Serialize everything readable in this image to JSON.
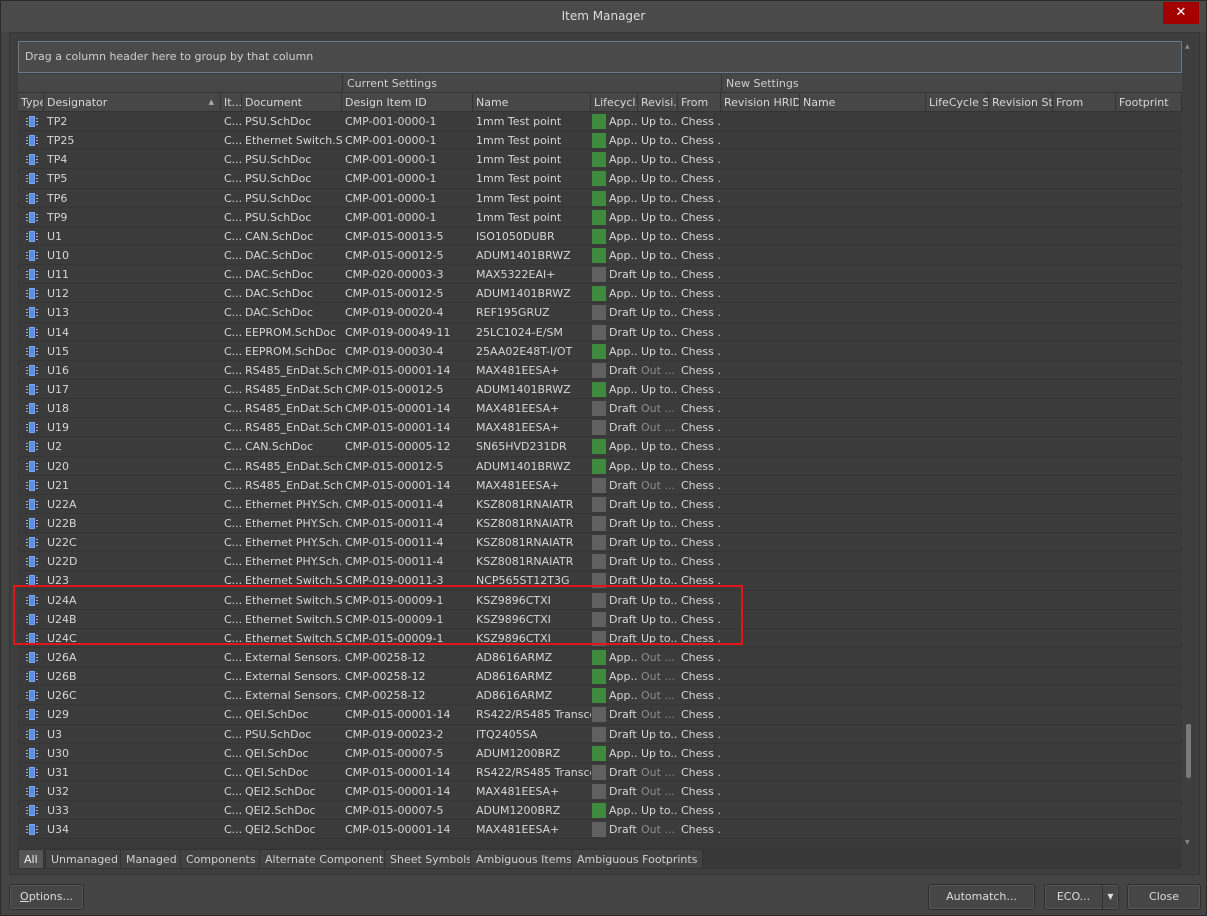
{
  "window": {
    "title": "Item Manager",
    "close_icon": "close-icon"
  },
  "group_bar": {
    "text": "Drag a column header here to group by that column"
  },
  "bands": {
    "current": "Current Settings",
    "new": "New Settings"
  },
  "columns": {
    "type": "Type",
    "designator": "Designator",
    "item": "It...",
    "document": "Document",
    "design_item_id": "Design Item ID",
    "name": "Name",
    "lifecycle": "Lifecycl...",
    "revision": "Revisi...",
    "from": "From",
    "new_revision_hrid": "Revision HRID",
    "new_name": "Name",
    "new_lifecycle": "LifeCycle S...",
    "new_revision_status": "Revision St...",
    "new_from": "From",
    "new_footprint": "Footprint"
  },
  "colors": {
    "approved": "#3f8a3f",
    "draft": "#606060",
    "highlight": "#e0161e"
  },
  "rows": [
    {
      "designator": "TP2",
      "item": "C...",
      "document": "PSU.SchDoc",
      "design_item_id": "CMP-001-0000-1",
      "name": "1mm Test point",
      "lifecycle": "App...",
      "lc": "approved",
      "revision": "Up to...",
      "rev_dim": false,
      "from": "Chess ..."
    },
    {
      "designator": "TP25",
      "item": "C...",
      "document": "Ethernet Switch.Sc...",
      "design_item_id": "CMP-001-0000-1",
      "name": "1mm Test point",
      "lifecycle": "App...",
      "lc": "approved",
      "revision": "Up to...",
      "rev_dim": false,
      "from": "Chess ..."
    },
    {
      "designator": "TP4",
      "item": "C...",
      "document": "PSU.SchDoc",
      "design_item_id": "CMP-001-0000-1",
      "name": "1mm Test point",
      "lifecycle": "App...",
      "lc": "approved",
      "revision": "Up to...",
      "rev_dim": false,
      "from": "Chess ..."
    },
    {
      "designator": "TP5",
      "item": "C...",
      "document": "PSU.SchDoc",
      "design_item_id": "CMP-001-0000-1",
      "name": "1mm Test point",
      "lifecycle": "App...",
      "lc": "approved",
      "revision": "Up to...",
      "rev_dim": false,
      "from": "Chess ..."
    },
    {
      "designator": "TP6",
      "item": "C...",
      "document": "PSU.SchDoc",
      "design_item_id": "CMP-001-0000-1",
      "name": "1mm Test point",
      "lifecycle": "App...",
      "lc": "approved",
      "revision": "Up to...",
      "rev_dim": false,
      "from": "Chess ..."
    },
    {
      "designator": "TP9",
      "item": "C...",
      "document": "PSU.SchDoc",
      "design_item_id": "CMP-001-0000-1",
      "name": "1mm Test point",
      "lifecycle": "App...",
      "lc": "approved",
      "revision": "Up to...",
      "rev_dim": false,
      "from": "Chess ..."
    },
    {
      "designator": "U1",
      "item": "C...",
      "document": "CAN.SchDoc",
      "design_item_id": "CMP-015-00013-5",
      "name": "ISO1050DUBR",
      "lifecycle": "App...",
      "lc": "approved",
      "revision": "Up to...",
      "rev_dim": false,
      "from": "Chess ..."
    },
    {
      "designator": "U10",
      "item": "C...",
      "document": "DAC.SchDoc",
      "design_item_id": "CMP-015-00012-5",
      "name": "ADUM1401BRWZ",
      "lifecycle": "App...",
      "lc": "approved",
      "revision": "Up to...",
      "rev_dim": false,
      "from": "Chess ..."
    },
    {
      "designator": "U11",
      "item": "C...",
      "document": "DAC.SchDoc",
      "design_item_id": "CMP-020-00003-3",
      "name": "MAX5322EAI+",
      "lifecycle": "Draft",
      "lc": "draft",
      "revision": "Up to...",
      "rev_dim": false,
      "from": "Chess ..."
    },
    {
      "designator": "U12",
      "item": "C...",
      "document": "DAC.SchDoc",
      "design_item_id": "CMP-015-00012-5",
      "name": "ADUM1401BRWZ",
      "lifecycle": "App...",
      "lc": "approved",
      "revision": "Up to...",
      "rev_dim": false,
      "from": "Chess ..."
    },
    {
      "designator": "U13",
      "item": "C...",
      "document": "DAC.SchDoc",
      "design_item_id": "CMP-019-00020-4",
      "name": "REF195GRUZ",
      "lifecycle": "Draft",
      "lc": "draft",
      "revision": "Up to...",
      "rev_dim": false,
      "from": "Chess ..."
    },
    {
      "designator": "U14",
      "item": "C...",
      "document": "EEPROM.SchDoc",
      "design_item_id": "CMP-019-00049-11",
      "name": "25LC1024-E/SM",
      "lifecycle": "Draft",
      "lc": "draft",
      "revision": "Up to...",
      "rev_dim": false,
      "from": "Chess ..."
    },
    {
      "designator": "U15",
      "item": "C...",
      "document": "EEPROM.SchDoc",
      "design_item_id": "CMP-019-00030-4",
      "name": "25AA02E48T-I/OT",
      "lifecycle": "App...",
      "lc": "approved",
      "revision": "Up to...",
      "rev_dim": false,
      "from": "Chess ..."
    },
    {
      "designator": "U16",
      "item": "C...",
      "document": "RS485_EnDat.Sch...",
      "design_item_id": "CMP-015-00001-14",
      "name": "MAX481EESA+",
      "lifecycle": "Draft",
      "lc": "draft",
      "revision": "Out ...",
      "rev_dim": true,
      "from": "Chess ..."
    },
    {
      "designator": "U17",
      "item": "C...",
      "document": "RS485_EnDat.Sch...",
      "design_item_id": "CMP-015-00012-5",
      "name": "ADUM1401BRWZ",
      "lifecycle": "App...",
      "lc": "approved",
      "revision": "Up to...",
      "rev_dim": false,
      "from": "Chess ..."
    },
    {
      "designator": "U18",
      "item": "C...",
      "document": "RS485_EnDat.Sch...",
      "design_item_id": "CMP-015-00001-14",
      "name": "MAX481EESA+",
      "lifecycle": "Draft",
      "lc": "draft",
      "revision": "Out ...",
      "rev_dim": true,
      "from": "Chess ..."
    },
    {
      "designator": "U19",
      "item": "C...",
      "document": "RS485_EnDat.Sch...",
      "design_item_id": "CMP-015-00001-14",
      "name": "MAX481EESA+",
      "lifecycle": "Draft",
      "lc": "draft",
      "revision": "Out ...",
      "rev_dim": true,
      "from": "Chess ..."
    },
    {
      "designator": "U2",
      "item": "C...",
      "document": "CAN.SchDoc",
      "design_item_id": "CMP-015-00005-12",
      "name": "SN65HVD231DR",
      "lifecycle": "App...",
      "lc": "approved",
      "revision": "Up to...",
      "rev_dim": false,
      "from": "Chess ..."
    },
    {
      "designator": "U20",
      "item": "C...",
      "document": "RS485_EnDat.Sch...",
      "design_item_id": "CMP-015-00012-5",
      "name": "ADUM1401BRWZ",
      "lifecycle": "App...",
      "lc": "approved",
      "revision": "Up to...",
      "rev_dim": false,
      "from": "Chess ..."
    },
    {
      "designator": "U21",
      "item": "C...",
      "document": "RS485_EnDat.Sch...",
      "design_item_id": "CMP-015-00001-14",
      "name": "MAX481EESA+",
      "lifecycle": "Draft",
      "lc": "draft",
      "revision": "Out ...",
      "rev_dim": true,
      "from": "Chess ..."
    },
    {
      "designator": "U22A",
      "item": "C...",
      "document": "Ethernet PHY.Sch...",
      "design_item_id": "CMP-015-00011-4",
      "name": "KSZ8081RNAIATR",
      "lifecycle": "Draft",
      "lc": "draft",
      "revision": "Up to...",
      "rev_dim": false,
      "from": "Chess ..."
    },
    {
      "designator": "U22B",
      "item": "C...",
      "document": "Ethernet PHY.Sch...",
      "design_item_id": "CMP-015-00011-4",
      "name": "KSZ8081RNAIATR",
      "lifecycle": "Draft",
      "lc": "draft",
      "revision": "Up to...",
      "rev_dim": false,
      "from": "Chess ..."
    },
    {
      "designator": "U22C",
      "item": "C...",
      "document": "Ethernet PHY.Sch...",
      "design_item_id": "CMP-015-00011-4",
      "name": "KSZ8081RNAIATR",
      "lifecycle": "Draft",
      "lc": "draft",
      "revision": "Up to...",
      "rev_dim": false,
      "from": "Chess ..."
    },
    {
      "designator": "U22D",
      "item": "C...",
      "document": "Ethernet PHY.Sch...",
      "design_item_id": "CMP-015-00011-4",
      "name": "KSZ8081RNAIATR",
      "lifecycle": "Draft",
      "lc": "draft",
      "revision": "Up to...",
      "rev_dim": false,
      "from": "Chess ..."
    },
    {
      "designator": "U23",
      "item": "C...",
      "document": "Ethernet Switch.Sc...",
      "design_item_id": "CMP-019-00011-3",
      "name": "NCP565ST12T3G",
      "lifecycle": "Draft",
      "lc": "draft",
      "revision": "Up to...",
      "rev_dim": false,
      "from": "Chess ..."
    },
    {
      "designator": "U24A",
      "item": "C...",
      "document": "Ethernet Switch.Sc...",
      "design_item_id": "CMP-015-00009-1",
      "name": "KSZ9896CTXI",
      "lifecycle": "Draft",
      "lc": "draft",
      "revision": "Up to...",
      "rev_dim": false,
      "from": "Chess ..."
    },
    {
      "designator": "U24B",
      "item": "C...",
      "document": "Ethernet Switch.Sc...",
      "design_item_id": "CMP-015-00009-1",
      "name": "KSZ9896CTXI",
      "lifecycle": "Draft",
      "lc": "draft",
      "revision": "Up to...",
      "rev_dim": false,
      "from": "Chess ..."
    },
    {
      "designator": "U24C",
      "item": "C...",
      "document": "Ethernet Switch.Sc...",
      "design_item_id": "CMP-015-00009-1",
      "name": "KSZ9896CTXI",
      "lifecycle": "Draft",
      "lc": "draft",
      "revision": "Up to...",
      "rev_dim": false,
      "from": "Chess ..."
    },
    {
      "designator": "U26A",
      "item": "C...",
      "document": "External Sensors.S...",
      "design_item_id": "CMP-00258-12",
      "name": "AD8616ARMZ",
      "lifecycle": "App...",
      "lc": "approved",
      "revision": "Out ...",
      "rev_dim": true,
      "from": "Chess ..."
    },
    {
      "designator": "U26B",
      "item": "C...",
      "document": "External Sensors.S...",
      "design_item_id": "CMP-00258-12",
      "name": "AD8616ARMZ",
      "lifecycle": "App...",
      "lc": "approved",
      "revision": "Out ...",
      "rev_dim": true,
      "from": "Chess ..."
    },
    {
      "designator": "U26C",
      "item": "C...",
      "document": "External Sensors.S...",
      "design_item_id": "CMP-00258-12",
      "name": "AD8616ARMZ",
      "lifecycle": "App...",
      "lc": "approved",
      "revision": "Out ...",
      "rev_dim": true,
      "from": "Chess ..."
    },
    {
      "designator": "U29",
      "item": "C...",
      "document": "QEI.SchDoc",
      "design_item_id": "CMP-015-00001-14",
      "name": "RS422/RS485 Transce...",
      "lifecycle": "Draft",
      "lc": "draft",
      "revision": "Out ...",
      "rev_dim": true,
      "from": "Chess ..."
    },
    {
      "designator": "U3",
      "item": "C...",
      "document": "PSU.SchDoc",
      "design_item_id": "CMP-019-00023-2",
      "name": "ITQ2405SA",
      "lifecycle": "Draft",
      "lc": "draft",
      "revision": "Up to...",
      "rev_dim": false,
      "from": "Chess ..."
    },
    {
      "designator": "U30",
      "item": "C...",
      "document": "QEI.SchDoc",
      "design_item_id": "CMP-015-00007-5",
      "name": "ADUM1200BRZ",
      "lifecycle": "App...",
      "lc": "approved",
      "revision": "Up to...",
      "rev_dim": false,
      "from": "Chess ..."
    },
    {
      "designator": "U31",
      "item": "C...",
      "document": "QEI.SchDoc",
      "design_item_id": "CMP-015-00001-14",
      "name": "RS422/RS485 Transce...",
      "lifecycle": "Draft",
      "lc": "draft",
      "revision": "Out ...",
      "rev_dim": true,
      "from": "Chess ..."
    },
    {
      "designator": "U32",
      "item": "C...",
      "document": "QEI2.SchDoc",
      "design_item_id": "CMP-015-00001-14",
      "name": "MAX481EESA+",
      "lifecycle": "Draft",
      "lc": "draft",
      "revision": "Out ...",
      "rev_dim": true,
      "from": "Chess ..."
    },
    {
      "designator": "U33",
      "item": "C...",
      "document": "QEI2.SchDoc",
      "design_item_id": "CMP-015-00007-5",
      "name": "ADUM1200BRZ",
      "lifecycle": "App...",
      "lc": "approved",
      "revision": "Up to...",
      "rev_dim": false,
      "from": "Chess ..."
    },
    {
      "designator": "U34",
      "item": "C...",
      "document": "QEI2.SchDoc",
      "design_item_id": "CMP-015-00001-14",
      "name": "MAX481EESA+",
      "lifecycle": "Draft",
      "lc": "draft",
      "revision": "Out ...",
      "rev_dim": true,
      "from": "Chess ..."
    }
  ],
  "highlighted_rows": [
    "U24A",
    "U24B",
    "U24C"
  ],
  "tabs": [
    "All",
    "Unmanaged",
    "Managed",
    "Components",
    "Alternate Components",
    "Sheet Symbols",
    "Ambiguous Items",
    "Ambiguous Footprints"
  ],
  "active_tab": "All",
  "buttons": {
    "options": "Options...",
    "automatch": "Automatch...",
    "eco": "ECO...",
    "close": "Close"
  }
}
